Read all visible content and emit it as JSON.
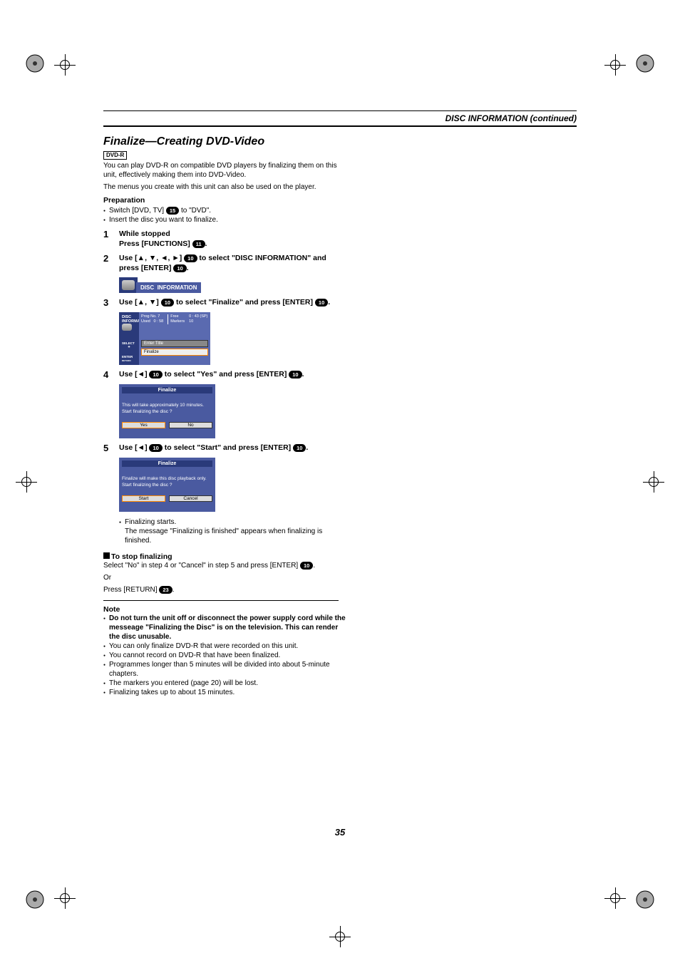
{
  "header": {
    "section_title": "DISC INFORMATION (continued)"
  },
  "section": {
    "title": "Finalize—Creating DVD-Video",
    "badge_label": "DVD-R",
    "intro1": "You can play DVD-R on compatible DVD players by finalizing them on this unit, effectively making them into DVD-Video.",
    "intro2": "The menus you create with this unit can also be used on the player."
  },
  "prep": {
    "heading": "Preparation",
    "b1a": "Switch [DVD, TV] ",
    "b1num": "15",
    "b1b": " to \"DVD\".",
    "b2": "Insert the disc you want to finalize."
  },
  "steps": [
    {
      "num": "1",
      "line1": "While stopped",
      "line2a": "Press [FUNCTIONS] ",
      "line2num": "11",
      "line2b": "."
    },
    {
      "num": "2",
      "body_a": "Use [▲, ▼, ◄, ►] ",
      "body_num": "10",
      "body_b": " to select \"DISC INFORMATION\" and press [ENTER] ",
      "body_num2": "10",
      "body_c": "."
    },
    {
      "num": "3",
      "body_a": "Use [▲, ▼] ",
      "body_num": "10",
      "body_b": " to select \"Finalize\" and press [ENTER] ",
      "body_num2": "10",
      "body_c": "."
    },
    {
      "num": "4",
      "body_a": "Use [◄] ",
      "body_num": "10",
      "body_b": " to select \"Yes\" and press [ENTER] ",
      "body_num2": "10",
      "body_c": "."
    },
    {
      "num": "5",
      "body_a": "Use [◄] ",
      "body_num": "10",
      "body_b": " to select \"Start\" and press [ENTER] ",
      "body_num2": "10",
      "body_c": "."
    }
  ],
  "osd1": {
    "text1": "DISC",
    "text2": "INFORMATION"
  },
  "osd2": {
    "side_top1": "DISC",
    "side_top2": "INFORMATION",
    "side_sel": "SELECT",
    "side_enter": "ENTER",
    "side_ret": "RETURN",
    "stats": {
      "c1l1": "Prog No.",
      "c1v1": "7",
      "c1l2": "Used",
      "c1v2": "0 : 58",
      "c2l1": "Free",
      "c2l2": "Markers",
      "c3v1": "0 : 43 (SP)",
      "c3v2": "10"
    },
    "menu1": "Enter Title",
    "menu2": "Finalize"
  },
  "dlg1": {
    "title": "Finalize",
    "text1": "This will take approximately 10 minutes.",
    "text2": "Start finalizing the disc ?",
    "btn1": "Yes",
    "btn2": "No"
  },
  "dlg2": {
    "title": "Finalize",
    "text1": "Finalize will make this disc playback only.",
    "text2": "Start finalizing the disc ?",
    "btn1": "Start",
    "btn2": "Cancel"
  },
  "after5": {
    "b1": "Finalizing starts.",
    "b2": "The message \"Finalizing is finished\" appears when finalizing is finished."
  },
  "stop": {
    "heading": "To stop finalizing",
    "t1": "Select \"No\" in step 4 or \"Cancel\" in step 5 and press [ENTER] ",
    "t1num": "10",
    "t1b": ".",
    "or": "Or",
    "t2a": "Press [RETURN] ",
    "t2num": "23",
    "t2b": "."
  },
  "note": {
    "heading": "Note",
    "b1": "Do not turn the unit off or disconnect the power supply cord while the messeage \"Finalizing the Disc\" is on the television. This can render the disc unusable.",
    "b2": "You can only finalize DVD-R that were recorded on this unit.",
    "b3": "You cannot record on DVD-R that have been finalized.",
    "b4": "Programmes longer than 5 minutes will be divided into about 5-minute chapters.",
    "b5": "The markers you entered (page 20) will be lost.",
    "b6": "Finalizing takes up to about 15 minutes."
  },
  "page_num": "35"
}
